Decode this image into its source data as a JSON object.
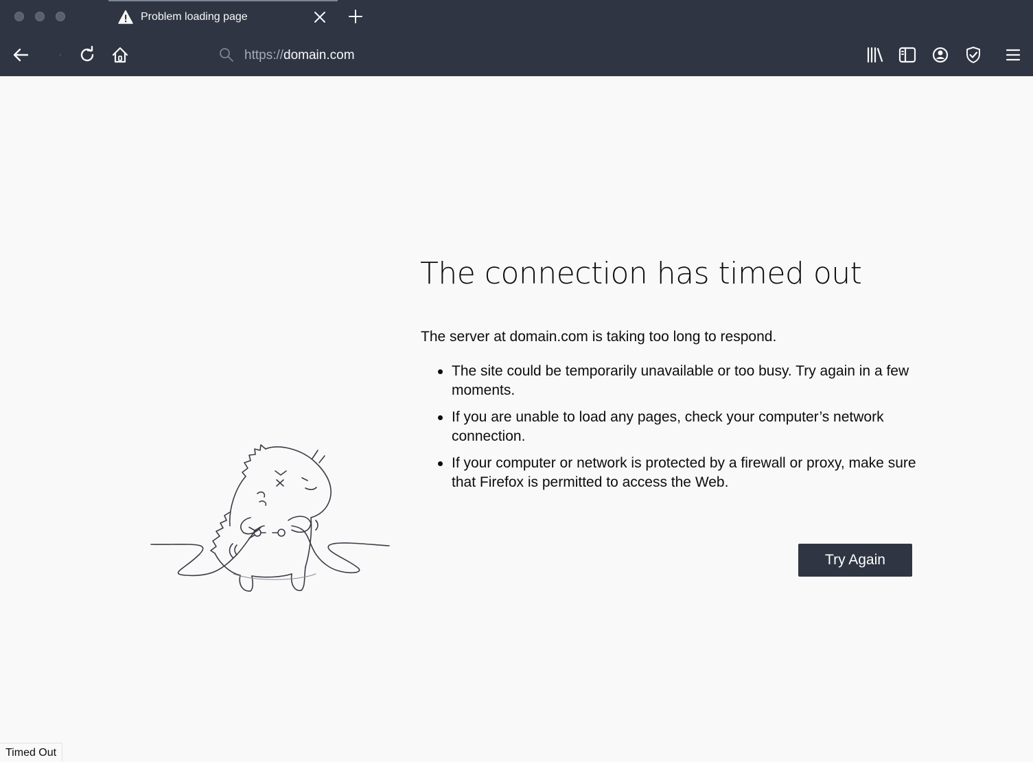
{
  "browser": {
    "tab": {
      "title": "Problem loading page",
      "icon": "warning-icon"
    },
    "toolbar": {
      "icons": [
        "back-icon",
        "forward-icon",
        "reload-icon",
        "home-icon",
        "search-icon",
        "library-icon",
        "sidebar-icon",
        "account-icon",
        "shield-icon",
        "menu-icon"
      ]
    },
    "urlbar": {
      "scheme": "https://",
      "host": "domain.com"
    },
    "colors": {
      "chrome": "#2f3542",
      "page_bg": "#f9f9fa",
      "button_bg": "#2f3542"
    }
  },
  "page": {
    "title": "The connection has timed out",
    "intro": "The server at domain.com is taking too long to respond.",
    "bullets": [
      "The site could be temporarily unavailable or too busy. Try again in a few moments.",
      "If you are unable to load any pages, check your computer’s network connection.",
      "If your computer or network is protected by a firewall or proxy, make sure that Firefox is permitted to access the Web."
    ],
    "try_again_label": "Try Again",
    "illustration": "dinosaur-unplugged-cable"
  },
  "statusbar": {
    "text": "Timed Out"
  }
}
